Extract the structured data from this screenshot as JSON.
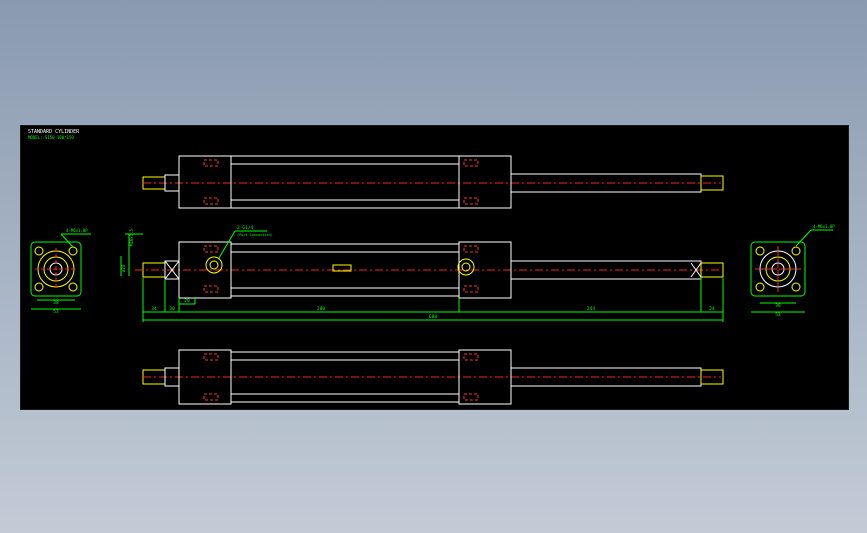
{
  "title_block": {
    "title": "STANDARD CYLINDER",
    "model": "MODEL: SI50 100*150"
  },
  "annotations": {
    "front_flange_callout": "4-M6x1.0P",
    "rear_flange_callout": "4-M6x1.0P",
    "port_callout": "2-G1/4",
    "port_note": "(Port Connection)",
    "rod_dia_label": "M16x1.5",
    "bore_label": "ø20"
  },
  "dimensions": {
    "front_width_inner": "38",
    "front_width_outer": "53",
    "rear_width_inner": "38",
    "rear_width_outer": "53",
    "thread_length": "34",
    "rod_stroke_offset": "30",
    "head_offset": "20",
    "body_length": "280",
    "rod_length": "244",
    "rod_end": "24",
    "overall_length": "688"
  },
  "colors": {
    "sheet": "#000000",
    "outline": "#ffffff",
    "center_line": "#ff2020",
    "dimension": "#00ff00",
    "highlight": "#ffff00",
    "hidden": "#ff3030"
  }
}
